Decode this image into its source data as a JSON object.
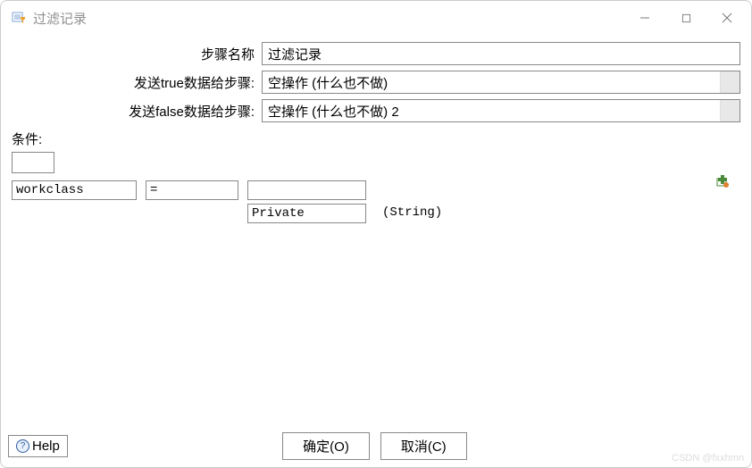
{
  "window": {
    "title": "过滤记录"
  },
  "form": {
    "step_name_label": "步骤名称",
    "step_name_value": "过滤记录",
    "send_true_label": "发送true数据给步骤:",
    "send_true_value": "空操作 (什么也不做)",
    "send_false_label": "发送false数据给步骤:",
    "send_false_value": "空操作 (什么也不做) 2"
  },
  "condition": {
    "label": "条件:",
    "field": "workclass",
    "operator": "=",
    "value_top": "",
    "value_bottom": "Private",
    "type": "(String)"
  },
  "footer": {
    "help": "Help",
    "ok": "确定(O)",
    "cancel": "取消(C)"
  },
  "watermark": "CSDN @fxxhmn"
}
